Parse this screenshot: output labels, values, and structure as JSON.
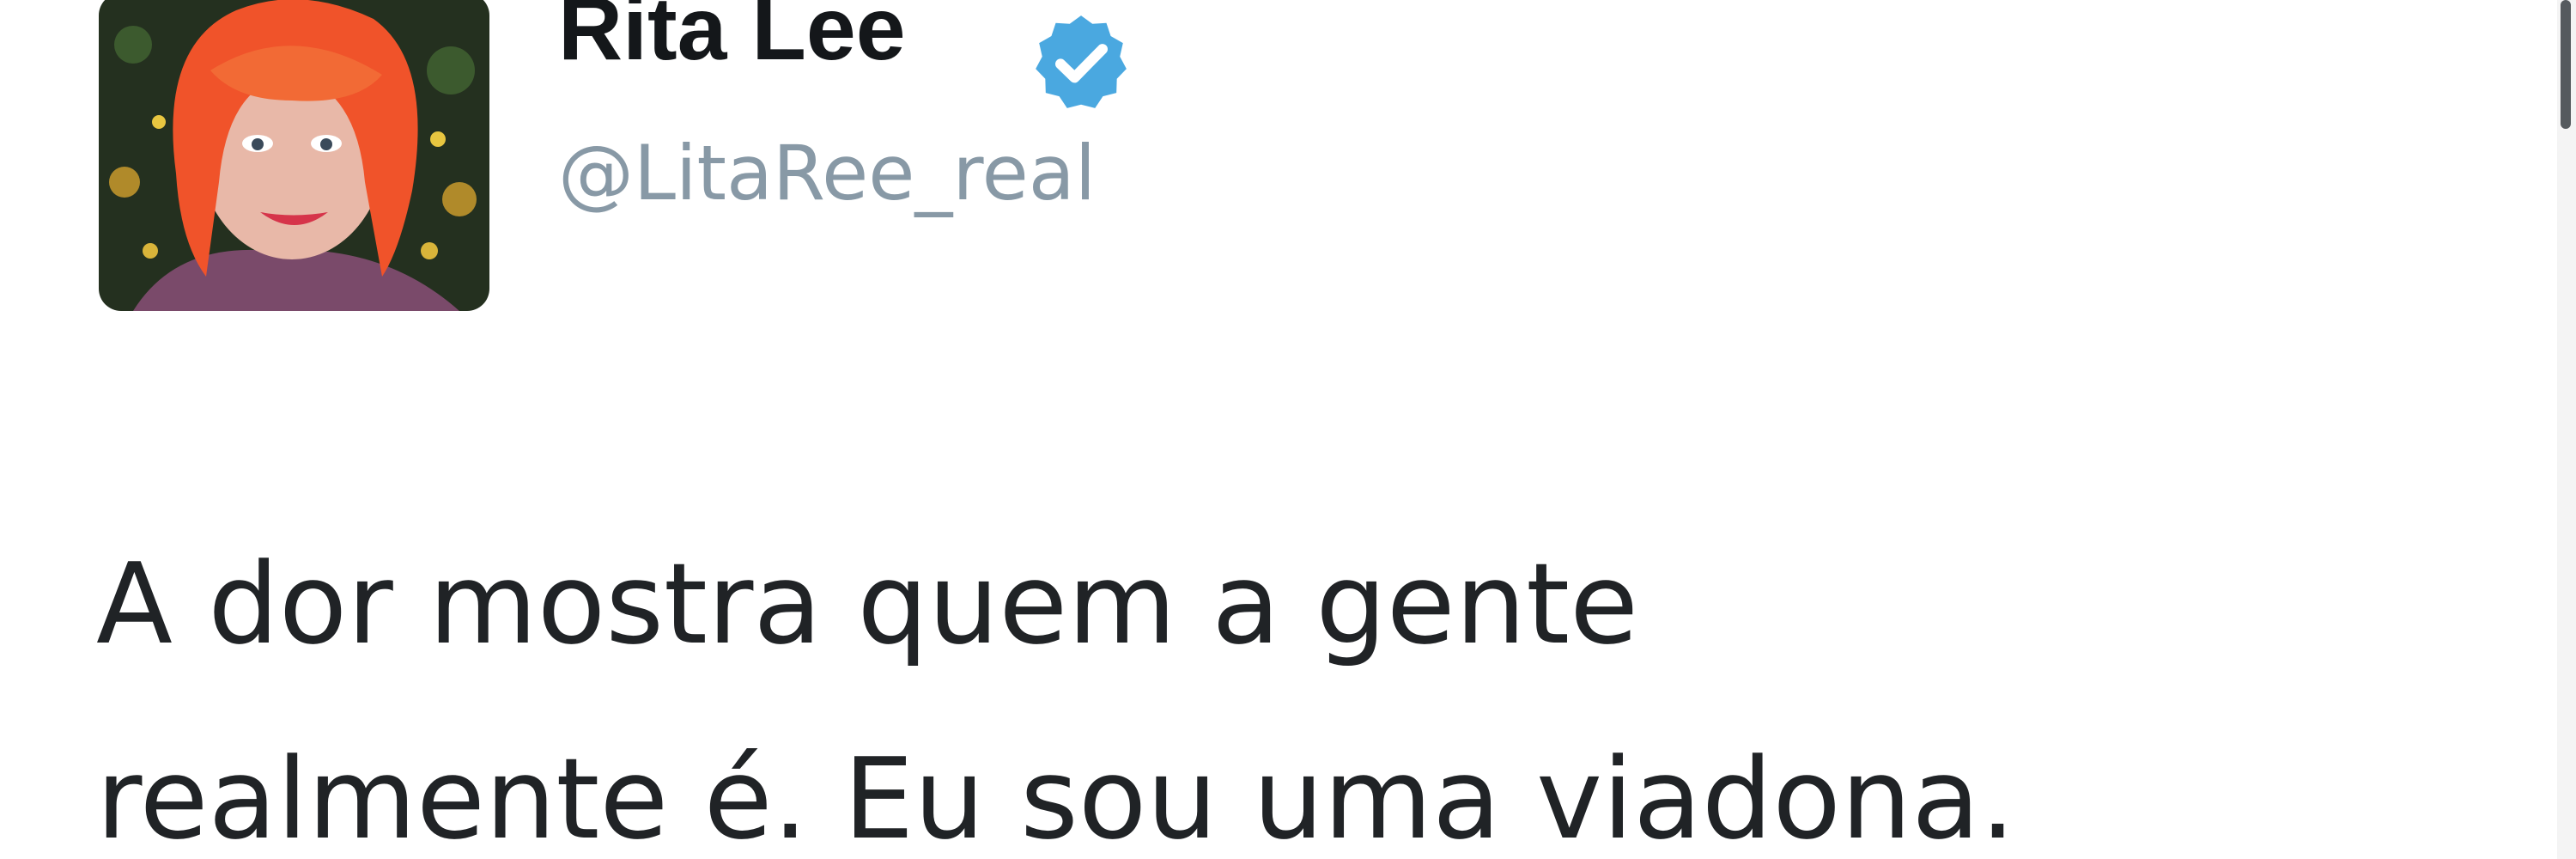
{
  "author": {
    "display_name": "Rita Lee",
    "handle": "@LitaRee_real",
    "verified": true,
    "avatar_icon": "profile-photo",
    "verified_icon": "verified-badge-icon",
    "verified_color": "#4aa8e0"
  },
  "tweet": {
    "lines": [
      "A dor mostra quem a gente",
      "realmente é. Eu sou uma viadona."
    ]
  },
  "colors": {
    "background": "#ffffff",
    "name": "#14171a",
    "handle": "#8899a6",
    "text": "#202326",
    "avatar_hair": "#f0532a",
    "avatar_background": "#2a3a24"
  }
}
